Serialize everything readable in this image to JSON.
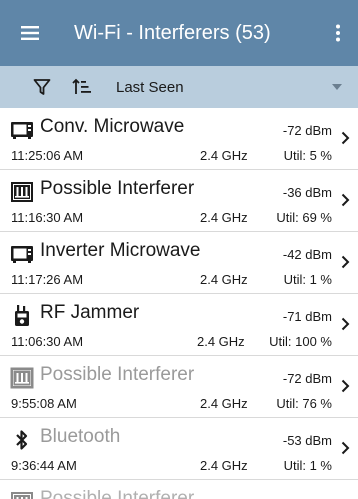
{
  "app_bar": {
    "title": "Wi-Fi - Interferers (53)",
    "menu_icon": "hamburger-menu-icon",
    "more_icon": "overflow-menu-icon"
  },
  "toolbar": {
    "filter_icon": "filter-icon",
    "sort_icon": "sort-icon",
    "sort_value": "Last Seen",
    "caret_icon": "dropdown-caret-icon"
  },
  "colors": {
    "app_bar": "#5f86a8",
    "toolbar": "#b9cddd",
    "dim_text": "#9a9a9a"
  },
  "interferers": [
    {
      "icon": "microwave-icon",
      "name": "Conv. Microwave",
      "time": "11:25:06 AM",
      "band": "2.4 GHz",
      "signal": "-72 dBm",
      "util": "Util: 5 %",
      "dim": false
    },
    {
      "icon": "interferer-icon",
      "name": "Possible Interferer",
      "time": "11:16:30 AM",
      "band": "2.4 GHz",
      "signal": "-36 dBm",
      "util": "Util: 69 %",
      "dim": false
    },
    {
      "icon": "microwave-icon",
      "name": "Inverter Microwave",
      "time": "11:17:26 AM",
      "band": "2.4 GHz",
      "signal": "-42 dBm",
      "util": "Util: 1 %",
      "dim": false
    },
    {
      "icon": "jammer-icon",
      "name": "RF Jammer",
      "time": "11:06:30 AM",
      "band": "2.4 GHz",
      "signal": "-71 dBm",
      "util": "Util: 100 %",
      "dim": false
    },
    {
      "icon": "interferer-icon",
      "name": "Possible Interferer",
      "time": "9:55:08 AM",
      "band": "2.4 GHz",
      "signal": "-72 dBm",
      "util": "Util: 76 %",
      "dim": true
    },
    {
      "icon": "bluetooth-icon",
      "name": "Bluetooth",
      "time": "9:36:44 AM",
      "band": "2.4 GHz",
      "signal": "-53 dBm",
      "util": "Util: 1 %",
      "dim": true
    }
  ],
  "partial_row": {
    "icon": "interferer-icon",
    "name": "Possible Interferer"
  }
}
